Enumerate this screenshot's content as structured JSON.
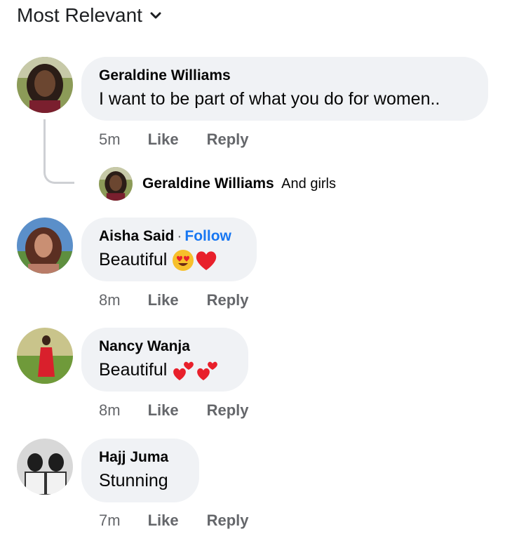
{
  "sort": {
    "label": "Most Relevant",
    "icon": "chevron-down-icon"
  },
  "comments": [
    {
      "name": "Geraldine Williams",
      "text": "I want to be part of what you do for women..",
      "time": "5m",
      "like": "Like",
      "reply": "Reply",
      "reply_preview": {
        "name": "Geraldine Williams",
        "text": "And girls"
      }
    },
    {
      "name": "Aisha Said",
      "separator": "·",
      "follow": "Follow",
      "text": "Beautiful",
      "emojis": [
        "heart-eyes-emoji",
        "red-heart-emoji"
      ],
      "time": "8m",
      "like": "Like",
      "reply": "Reply"
    },
    {
      "name": "Nancy Wanja",
      "text": "Beautiful",
      "emojis": [
        "two-hearts-emoji",
        "two-hearts-emoji"
      ],
      "time": "8m",
      "like": "Like",
      "reply": "Reply"
    },
    {
      "name": "Hajj Juma",
      "text": "Stunning",
      "time": "7m",
      "like": "Like",
      "reply": "Reply"
    }
  ],
  "colors": {
    "bubble": "#f0f2f5",
    "meta": "#65676b",
    "link": "#1877f2",
    "thread": "#ced0d4"
  }
}
